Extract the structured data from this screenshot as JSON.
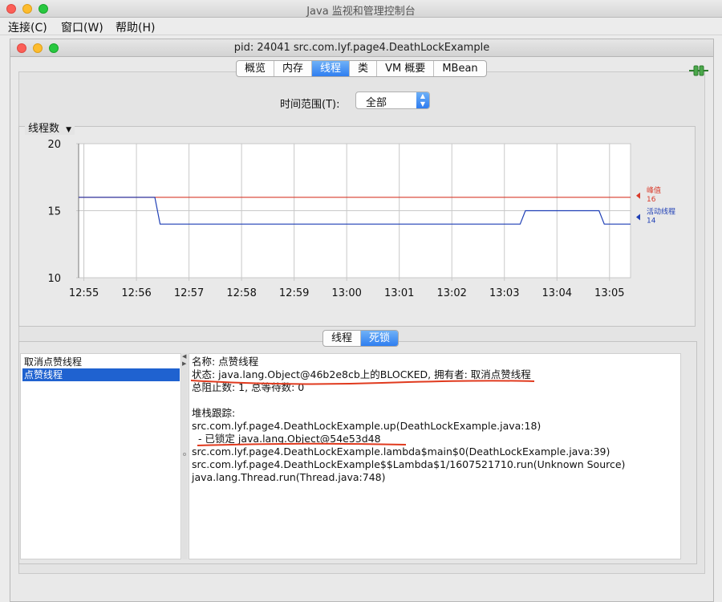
{
  "app": {
    "title": "Java 监视和管理控制台",
    "menu": [
      "连接(C)",
      "窗口(W)",
      "帮助(H)"
    ]
  },
  "window": {
    "title": "pid: 24041 src.com.lyf.page4.DeathLockExample",
    "tabs": [
      "概览",
      "内存",
      "线程",
      "类",
      "VM 概要",
      "MBean"
    ],
    "active_tab": "线程"
  },
  "time_range": {
    "label": "时间范围(T):",
    "value": "全部"
  },
  "chart": {
    "title": "线程数",
    "legend": [
      {
        "label": "峰值",
        "value": "16",
        "color": "#d93b2b"
      },
      {
        "label": "活动线程",
        "value": "14",
        "color": "#1f3fb5"
      }
    ]
  },
  "chart_data": {
    "type": "line",
    "title": "线程数",
    "ylim": [
      10,
      20
    ],
    "yticks": [
      "20",
      "15",
      "10"
    ],
    "xticks": [
      "12:55",
      "12:56",
      "12:57",
      "12:58",
      "12:59",
      "13:00",
      "13:01",
      "13:02",
      "13:03",
      "13:04",
      "13:05"
    ],
    "xlim": [
      12.9,
      23.4
    ],
    "series": [
      {
        "name": "峰值",
        "color": "#d93b2b",
        "x": [
          12.9,
          23.4
        ],
        "y": [
          16,
          16
        ]
      },
      {
        "name": "活动线程",
        "color": "#1f3fb5",
        "x": [
          12.9,
          14.35,
          14.45,
          21.3,
          21.4,
          22.8,
          22.9,
          23.4
        ],
        "y": [
          16,
          16,
          14,
          14,
          15,
          15,
          14,
          14
        ]
      }
    ]
  },
  "lower_tabs": [
    "线程",
    "死锁"
  ],
  "lower_active_tab": "死锁",
  "threads": [
    {
      "name": "取消点赞线程",
      "selected": false
    },
    {
      "name": "点赞线程",
      "selected": true
    }
  ],
  "detail": {
    "name": "名称: 点赞线程",
    "state": "状态: java.lang.Object@46b2e8cb上的BLOCKED, 拥有者: 取消点赞线程",
    "counts": "总阻止数: 1, 总等待数: 0",
    "stack_header": "堆栈跟踪:",
    "stack": [
      "src.com.lyf.page4.DeathLockExample.up(DeathLockExample.java:18)",
      "  - 已锁定 java.lang.Object@54e53d48",
      "src.com.lyf.page4.DeathLockExample.lambda$main$0(DeathLockExample.java:39)",
      "src.com.lyf.page4.DeathLockExample$$Lambda$1/1607521710.run(Unknown Source)",
      "java.lang.Thread.run(Thread.java:748)"
    ]
  }
}
